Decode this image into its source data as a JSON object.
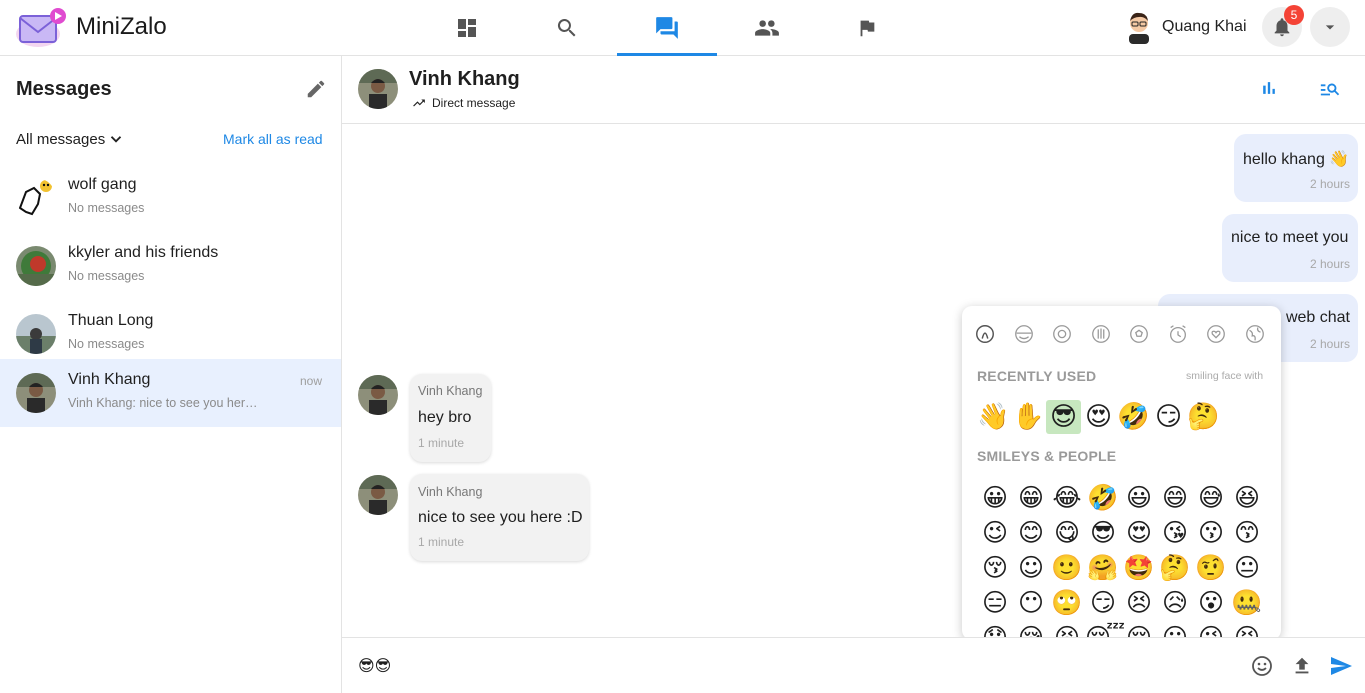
{
  "app": {
    "title": "MiniZalo"
  },
  "nav": {
    "items": [
      {
        "name": "dashboard",
        "icon": "dashboard-icon",
        "active": false
      },
      {
        "name": "search",
        "icon": "search-icon",
        "active": false
      },
      {
        "name": "messages",
        "icon": "forum-icon",
        "active": true
      },
      {
        "name": "friends",
        "icon": "people-icon",
        "active": false
      },
      {
        "name": "reports",
        "icon": "flag-icon",
        "active": false
      }
    ]
  },
  "user": {
    "name": "Quang Khai",
    "notifications": "5"
  },
  "sidebar": {
    "title": "Messages",
    "filter": "All messages",
    "mark_all": "Mark all as read",
    "conversations": [
      {
        "name": "wolf gang",
        "preview": "No messages",
        "time": ""
      },
      {
        "name": "kkyler and his friends",
        "preview": "No messages",
        "time": ""
      },
      {
        "name": "Thuan Long",
        "preview": "No messages",
        "time": ""
      },
      {
        "name": "Vinh Khang",
        "preview": "Vinh Khang: nice to see you here :D",
        "time": "now"
      }
    ]
  },
  "chat": {
    "name": "Vinh Khang",
    "subtitle": "Direct message",
    "outgoing": [
      {
        "text": "hello khang 👋",
        "time": "2 hours"
      },
      {
        "text": "nice to meet you",
        "time": "2 hours"
      },
      {
        "text": "web chat",
        "time": "2 hours"
      }
    ],
    "incoming": [
      {
        "sender": "Vinh Khang",
        "text": "hey bro",
        "time": "1 minute"
      },
      {
        "sender": "Vinh Khang",
        "text": "nice to see you here :D",
        "time": "1 minute"
      }
    ]
  },
  "composer": {
    "value": "😎😎"
  },
  "emoji_picker": {
    "recent_label": "RECENTLY USED",
    "hint": "smiling face with",
    "smileys_label": "SMILEYS & PEOPLE",
    "recent": [
      "👋",
      "✋",
      "😎",
      "😍",
      "🤣",
      "😏",
      "🤔"
    ],
    "smileys": [
      "😀",
      "😁",
      "😂",
      "🤣",
      "😃",
      "😄",
      "😅",
      "😆",
      "😉",
      "😊",
      "😋",
      "😎",
      "😍",
      "😘",
      "😗",
      "😙",
      "😚",
      "☺",
      "🙂",
      "🤗",
      "🤩",
      "🤔",
      "🤨",
      "😐",
      "😑",
      "😶",
      "🙄",
      "😏",
      "😣",
      "😥",
      "😮",
      "🤐",
      "😯",
      "😪",
      "😫",
      "😴",
      "😌",
      "😛",
      "😜",
      "😝"
    ]
  },
  "colors": {
    "accent": "#1e88e5",
    "active_row": "#e8f0fe",
    "outgoing_bubble": "#e8eefc",
    "badge": "#f44336"
  }
}
